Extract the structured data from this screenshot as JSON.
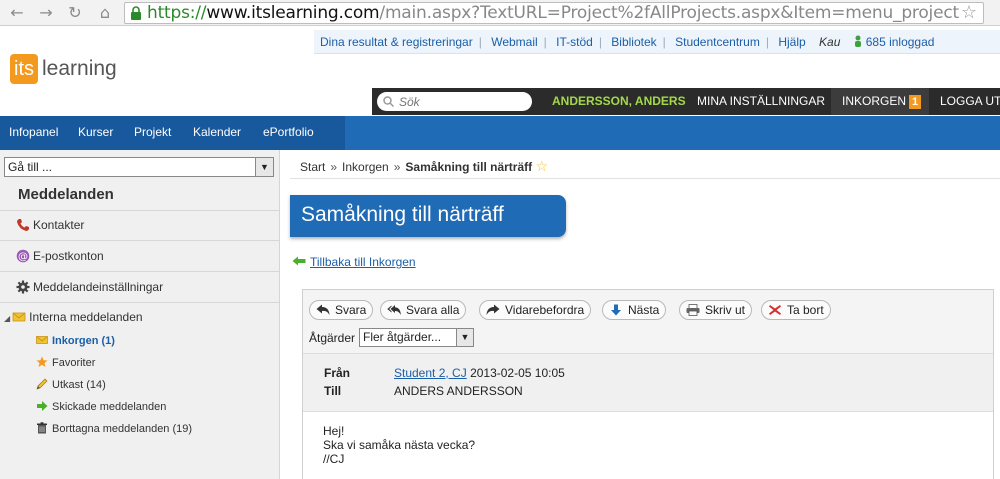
{
  "browser": {
    "url_scheme": "https://",
    "url_host": "www.itslearning.com",
    "url_path": "/main.aspx?TextURL=Project%2fAllProjects.aspx&Item=menu_project"
  },
  "logo": {
    "part1": "its",
    "part2": "learning"
  },
  "top_links": {
    "items": [
      "Dina resultat & registreringar",
      "Webmail",
      "IT-stöd",
      "Bibliotek",
      "Studentcentrum",
      "Hjälp"
    ],
    "org": "Kau",
    "online": "685 inloggad"
  },
  "header": {
    "search_placeholder": "Sök",
    "user_name": "ANDERSSON, ANDERS",
    "settings": "MINA INSTÄLLNINGAR",
    "inbox": "INKORGEN",
    "inbox_count": "1",
    "logout": "LOGGA UT"
  },
  "main_nav": [
    "Infopanel",
    "Kurser",
    "Projekt",
    "Kalender",
    "ePortfolio"
  ],
  "sidebar": {
    "goto": "Gå till ...",
    "title": "Meddelanden",
    "items": [
      "Kontakter",
      "E-postkonton",
      "Meddelandeinställningar",
      "Interna meddelanden"
    ],
    "sub_items": [
      "Inkorgen (1)",
      "Favoriter",
      "Utkast (14)",
      "Skickade meddelanden",
      "Borttagna meddelanden (19)"
    ]
  },
  "breadcrumb": {
    "start": "Start",
    "inbox": "Inkorgen",
    "current": "Samåkning till närträff"
  },
  "page_title": "Samåkning till närträff",
  "back_link": "Tillbaka till Inkorgen",
  "toolbar": {
    "buttons": [
      "Svara",
      "Svara alla",
      "Vidarebefordra",
      "Nästa",
      "Skriv ut",
      "Ta bort"
    ],
    "actions_label": "Åtgärder",
    "actions_value": "Fler åtgärder..."
  },
  "message": {
    "from_label": "Från",
    "from_name": "Student 2, CJ",
    "date": "2013-02-05 10:05",
    "to_label": "Till",
    "to_name": "ANDERS ANDERSSON",
    "body": [
      "Hej!",
      "Ska vi samåka nästa vecka?",
      "//CJ"
    ]
  },
  "colors": {
    "brand_blue": "#1f6bb5",
    "accent_orange": "#f39a1e",
    "user_green": "#a3d94a"
  }
}
